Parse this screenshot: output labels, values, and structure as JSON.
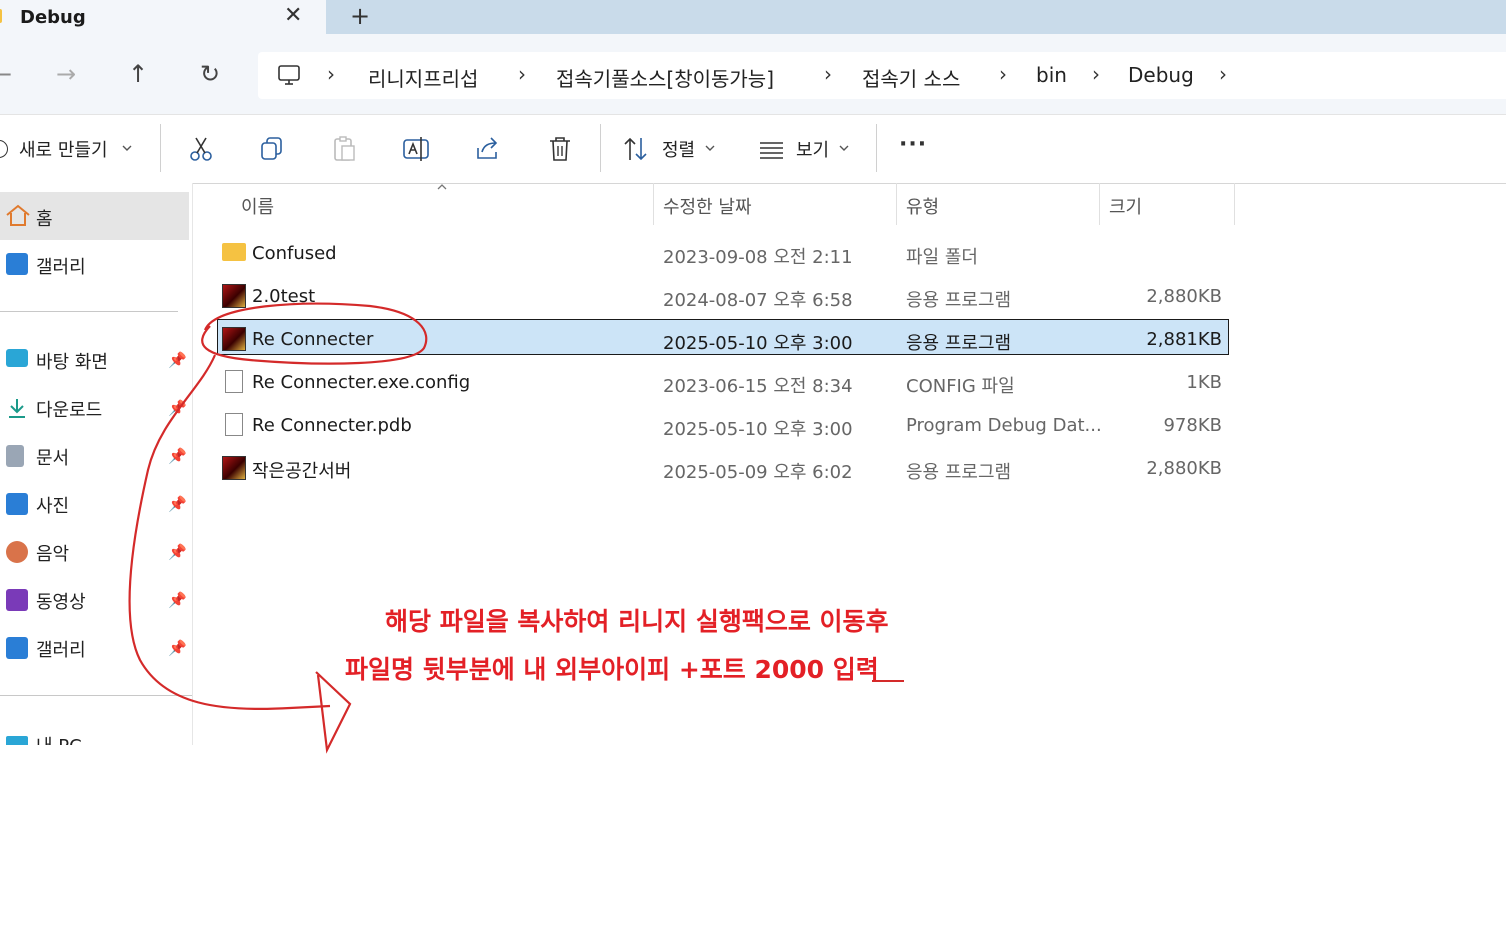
{
  "tab": {
    "title": "Debug",
    "close": "✕",
    "new": "+"
  },
  "nav": {
    "back": "←",
    "forward": "→",
    "up": "↑",
    "refresh": "↻"
  },
  "breadcrumbs": [
    "리니지프리섭",
    "접속기풀소스[창이동가능]",
    "접속기 소스",
    "bin",
    "Debug"
  ],
  "breadcrumb_separator": "›",
  "toolbar": {
    "new_label": "새로 만들기",
    "sort_label": "정렬",
    "view_label": "보기",
    "more": "···"
  },
  "sidebar": {
    "top": [
      {
        "label": "홈",
        "icon": "home-icon",
        "selected": true
      },
      {
        "label": "갤러리",
        "icon": "gallery-icon"
      }
    ],
    "pinned": [
      {
        "label": "바탕 화면",
        "icon": "desktop-icon"
      },
      {
        "label": "다운로드",
        "icon": "download-icon"
      },
      {
        "label": "문서",
        "icon": "documents-icon"
      },
      {
        "label": "사진",
        "icon": "pictures-icon"
      },
      {
        "label": "음악",
        "icon": "music-icon"
      },
      {
        "label": "동영상",
        "icon": "videos-icon"
      },
      {
        "label": "갤러리",
        "icon": "gallery-icon"
      }
    ],
    "bottom_partial": "내 PC"
  },
  "columns": {
    "name": "이름",
    "date": "수정한 날짜",
    "type": "유형",
    "size": "크기"
  },
  "files": [
    {
      "name": "Confused",
      "date": "2023-09-08 오전 2:11",
      "type": "파일 폴더",
      "size": "",
      "icon": "folder-icon"
    },
    {
      "name": "2.0test",
      "date": "2024-08-07 오후 6:58",
      "type": "응용 프로그램",
      "size": "2,880KB",
      "icon": "app-icon"
    },
    {
      "name": "Re Connecter",
      "date": "2025-05-10 오후 3:00",
      "type": "응용 프로그램",
      "size": "2,881KB",
      "icon": "app-icon",
      "selected": true
    },
    {
      "name": "Re Connecter.exe.config",
      "date": "2023-06-15 오전 8:34",
      "type": "CONFIG 파일",
      "size": "1KB",
      "icon": "file-icon"
    },
    {
      "name": "Re Connecter.pdb",
      "date": "2025-05-10 오후 3:00",
      "type": "Program Debug Dat...",
      "size": "978KB",
      "icon": "file-icon"
    },
    {
      "name": "작은공간서버",
      "date": "2025-05-09 오후 6:02",
      "type": "응용 프로그램",
      "size": "2,880KB",
      "icon": "app-icon"
    }
  ],
  "annotation": {
    "line1": "해당 파일을 복사하여 리니지 실행팩으로 이동후",
    "line2": "파일명 뒷부분에 내 외부아이피 +포트 2000 입력",
    "color": "#e32026"
  }
}
